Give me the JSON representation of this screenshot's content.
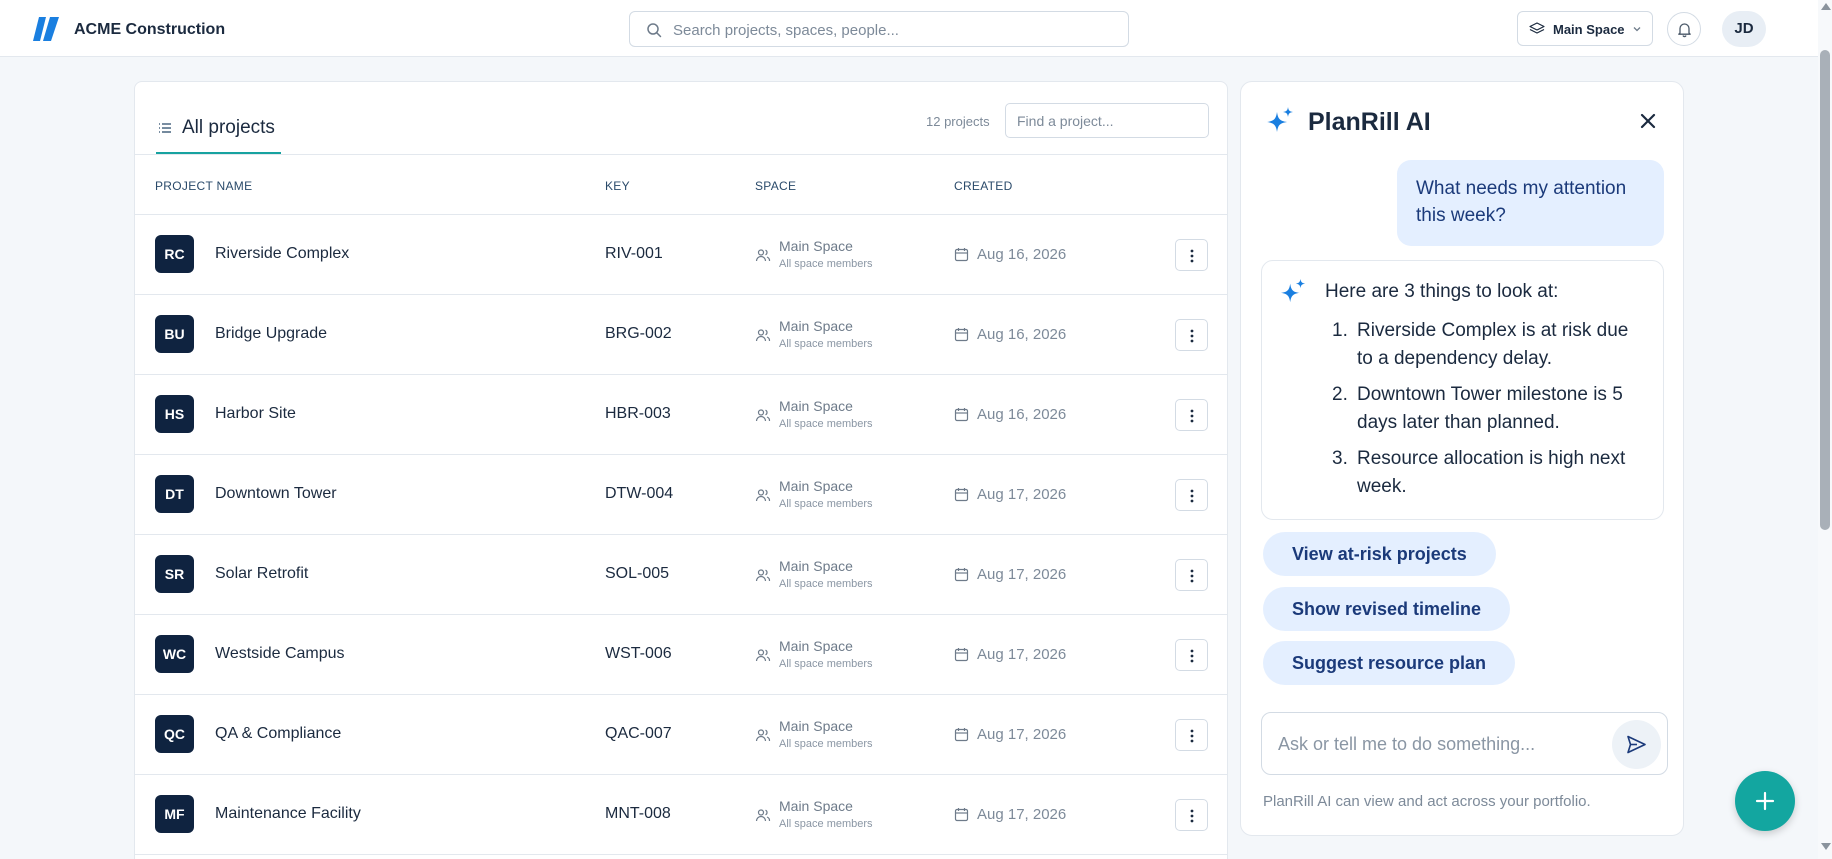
{
  "app": {
    "brand_name": "ACME Construction",
    "search_placeholder": "Search projects, spaces, people...",
    "space_selector": "Main Space",
    "user_initials": "JD",
    "accent_color": "#17a2a0",
    "brand_color": "#1a7fe0"
  },
  "projects": {
    "tab_label": "All projects",
    "count_label": "12 projects",
    "find_placeholder": "Find a project...",
    "columns": [
      "PROJECT NAME",
      "KEY",
      "SPACE",
      "CREATED"
    ],
    "rows": [
      {
        "initials": "RC",
        "name": "Riverside Complex",
        "key": "RIV-001",
        "space": "Main Space",
        "space_sub": "All space members",
        "created": "Aug 16, 2026"
      },
      {
        "initials": "BU",
        "name": "Bridge Upgrade",
        "key": "BRG-002",
        "space": "Main Space",
        "space_sub": "All space members",
        "created": "Aug 16, 2026"
      },
      {
        "initials": "HS",
        "name": "Harbor Site",
        "key": "HBR-003",
        "space": "Main Space",
        "space_sub": "All space members",
        "created": "Aug 16, 2026"
      },
      {
        "initials": "DT",
        "name": "Downtown Tower",
        "key": "DTW-004",
        "space": "Main Space",
        "space_sub": "All space members",
        "created": "Aug 17, 2026"
      },
      {
        "initials": "SR",
        "name": "Solar Retrofit",
        "key": "SOL-005",
        "space": "Main Space",
        "space_sub": "All space members",
        "created": "Aug 17, 2026"
      },
      {
        "initials": "WC",
        "name": "Westside Campus",
        "key": "WST-006",
        "space": "Main Space",
        "space_sub": "All space members",
        "created": "Aug 17, 2026"
      },
      {
        "initials": "QC",
        "name": "QA & Compliance",
        "key": "QAC-007",
        "space": "Main Space",
        "space_sub": "All space members",
        "created": "Aug 17, 2026"
      },
      {
        "initials": "MF",
        "name": "Maintenance Facility",
        "key": "MNT-008",
        "space": "Main Space",
        "space_sub": "All space members",
        "created": "Aug 17, 2026"
      }
    ]
  },
  "ai_panel": {
    "title": "PlanRill AI",
    "user_message": "What needs my attention this week?",
    "answer_intro": "Here are 3 things to look at:",
    "answer_items": [
      "Riverside Complex is at risk due to a dependency delay.",
      "Downtown Tower milestone is 5 days later than planned.",
      "Resource allocation is high next week."
    ],
    "suggestions": [
      "View at-risk projects",
      "Show revised timeline",
      "Suggest resource plan"
    ],
    "input_placeholder": "Ask or tell me to do something...",
    "footnote": "PlanRill AI can view and act across your portfolio."
  }
}
